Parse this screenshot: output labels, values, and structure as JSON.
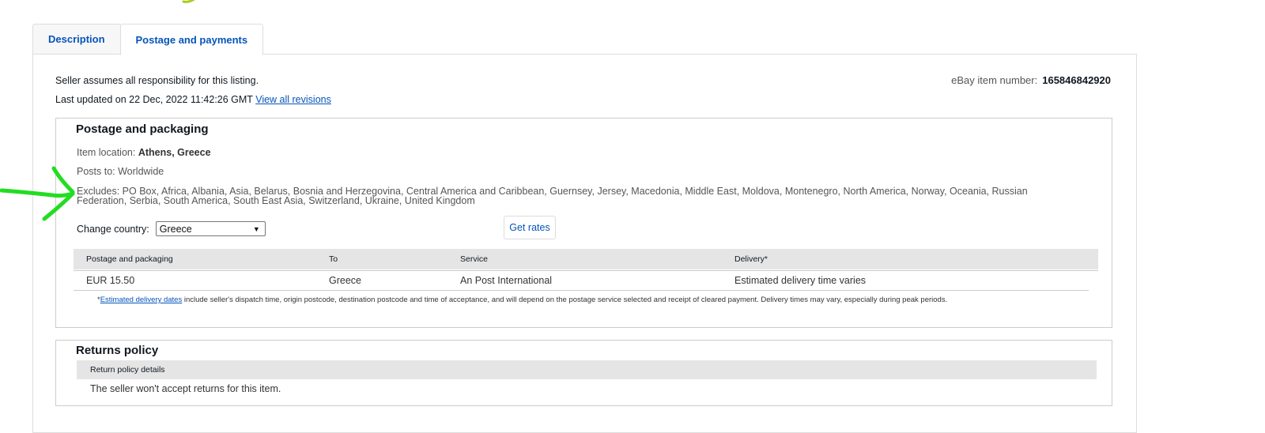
{
  "tabs": [
    {
      "label": "Description",
      "active": false
    },
    {
      "label": "Postage and payments",
      "active": true
    }
  ],
  "seller_note": "Seller assumes all responsibility for this listing.",
  "last_updated": {
    "text": "Last updated on 22 Dec, 2022 11:42:26 GMT",
    "link": "View all revisions"
  },
  "item_number": {
    "label": "eBay item number:",
    "value": "165846842920"
  },
  "postage": {
    "title": "Postage and packaging",
    "location_label": "Item location:",
    "location_value": "Athens, Greece",
    "posts_to": "Posts to:  Worldwide",
    "excludes": "Excludes:  PO Box, Africa, Albania, Asia, Belarus, Bosnia and Herzegovina, Central America and Caribbean, Guernsey, Jersey, Macedonia, Middle East, Moldova, Montenegro, North America, Norway, Oceania, Russian Federation, Serbia, South America, South East Asia, Switzerland, Ukraine, United Kingdom",
    "change_country_label": "Change country:",
    "country_selected": "Greece",
    "get_rates": "Get rates",
    "table": {
      "headers": [
        "Postage and packaging",
        "To",
        "Service",
        "Delivery*"
      ],
      "rows": [
        [
          "EUR 15.50",
          "Greece",
          "An Post International",
          "Estimated delivery time varies"
        ]
      ]
    },
    "note_star": "*",
    "note_link": "Estimated delivery dates",
    "note_text": " include seller's dispatch time, origin postcode, destination postcode and time of acceptance, and will depend on the postage service selected and receipt of cleared payment. Delivery times may vary, especially during peak periods."
  },
  "returns": {
    "title": "Returns policy",
    "header": "Return policy details",
    "text": "The seller won't accept returns for this item."
  },
  "colors": {
    "link": "#0654ba",
    "annotation": "#22dd22"
  }
}
